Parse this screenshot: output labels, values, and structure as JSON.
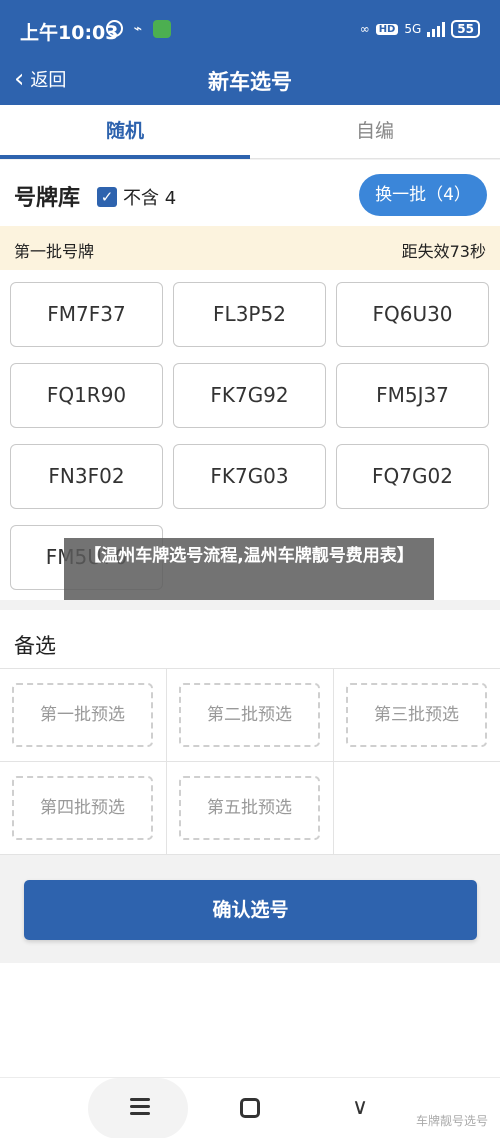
{
  "status_bar": {
    "time": "上午10:03",
    "hd": "HD",
    "net": "5G",
    "battery": "55"
  },
  "nav": {
    "back_label": "返回",
    "title": "新车选号"
  },
  "tabs": [
    {
      "label": "随机",
      "active": true
    },
    {
      "label": "自编",
      "active": false
    }
  ],
  "pool": {
    "title": "号牌库",
    "exclude_label": "不含 4",
    "exclude_checked": true,
    "refresh_label": "换一批（4）"
  },
  "batch": {
    "name": "第一批号牌",
    "countdown": "距失效73秒"
  },
  "plates": [
    "FM7F37",
    "FL3P52",
    "FQ6U30",
    "FQ1R90",
    "FK7G92",
    "FM5J37",
    "FN3F02",
    "FK7G03",
    "FQ7G02",
    "FM5U70"
  ],
  "overlay_text": "【温州车牌选号流程,温州车牌靓号费用表】",
  "alternates": {
    "title": "备选",
    "slots": [
      "第一批预选",
      "第二批预选",
      "第三批预选",
      "第四批预选",
      "第五批预选"
    ]
  },
  "confirm_label": "确认选号",
  "watermark": "车牌靓号选号",
  "colors": {
    "primary": "#2e63ae",
    "refresh_button": "#3b86d9",
    "batch_background": "#fcf3de"
  }
}
